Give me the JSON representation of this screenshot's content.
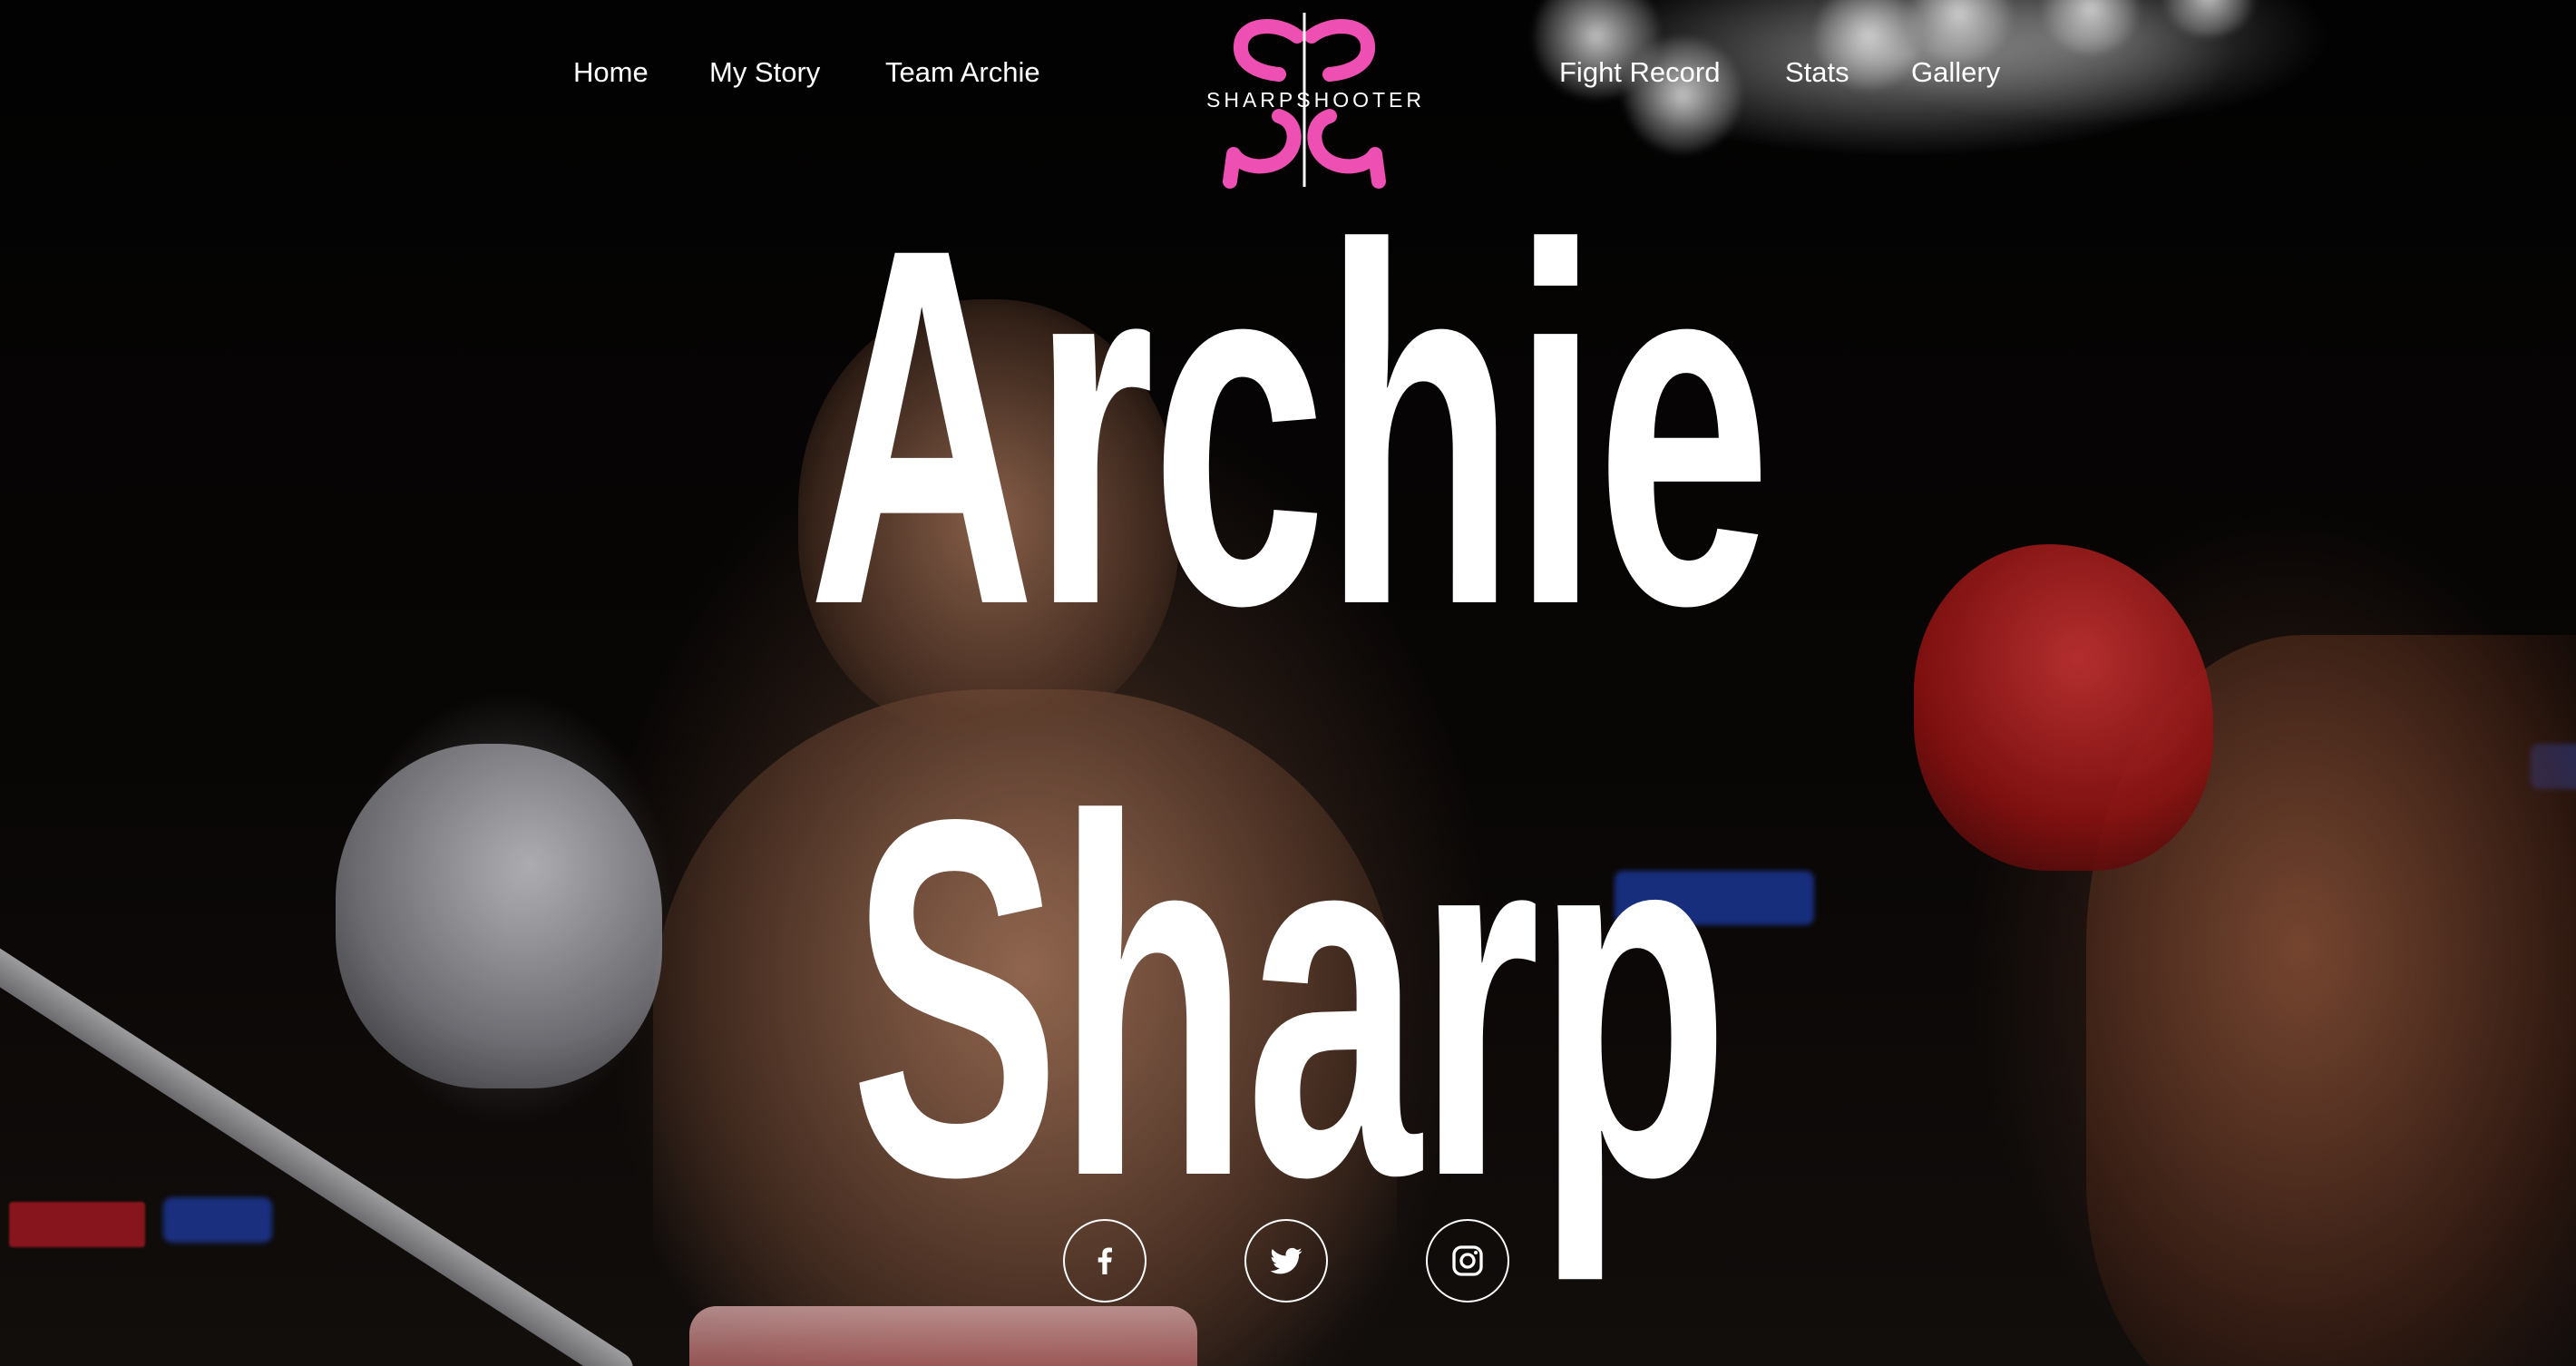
{
  "nav": {
    "left_links": [
      {
        "label": "Home"
      },
      {
        "label": "My Story"
      },
      {
        "label": "Team Archie"
      }
    ],
    "right_links": [
      {
        "label": "Fight Record"
      },
      {
        "label": "Stats"
      },
      {
        "label": "Gallery"
      }
    ],
    "logo": {
      "text": "SHARPSHOOTER",
      "color": "#ee4fb3"
    }
  },
  "hero": {
    "line1": "Archie",
    "line2": "Sharp"
  },
  "social": [
    {
      "icon": "facebook-icon"
    },
    {
      "icon": "twitter-icon"
    },
    {
      "icon": "instagram-icon"
    }
  ]
}
